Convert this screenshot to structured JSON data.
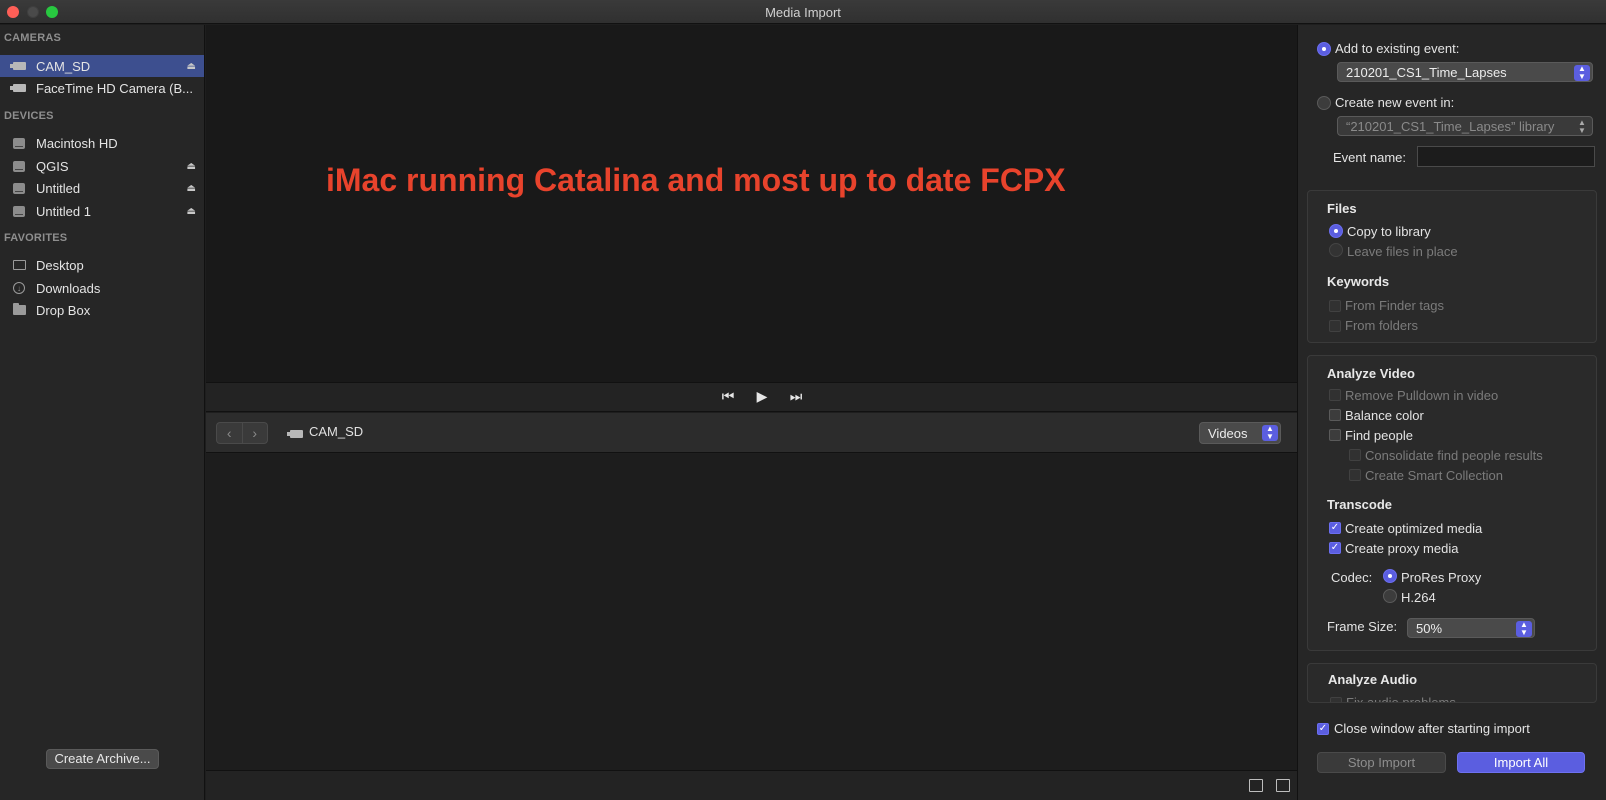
{
  "window": {
    "title": "Media Import"
  },
  "sidebar": {
    "cameras_header": "CAMERAS",
    "cameras": [
      {
        "label": "CAM_SD",
        "selected": true,
        "eject": true
      },
      {
        "label": "FaceTime HD Camera (B..."
      }
    ],
    "devices_header": "DEVICES",
    "devices": [
      {
        "label": "Macintosh HD"
      },
      {
        "label": "QGIS",
        "eject": true
      },
      {
        "label": "Untitled",
        "eject": true
      },
      {
        "label": "Untitled 1",
        "eject": true
      }
    ],
    "favorites_header": "FAVORITES",
    "favorites": [
      {
        "label": "Desktop"
      },
      {
        "label": "Downloads"
      },
      {
        "label": "Drop Box"
      }
    ],
    "eject_glyph": "⏏",
    "create_archive_label": "Create Archive..."
  },
  "viewer": {
    "overlay_text": "iMac running Catalina and most up to date FCPX"
  },
  "browser": {
    "location_label": "CAM_SD",
    "filter_value": "Videos"
  },
  "options": {
    "add_existing_label": "Add to existing event:",
    "existing_event_value": "210201_CS1_Time_Lapses",
    "create_new_label": "Create new event in:",
    "new_event_library": "“210201_CS1_Time_Lapses” library",
    "event_name_label": "Event name:",
    "event_name_value": "",
    "files_header": "Files",
    "copy_to_library": "Copy to library",
    "leave_in_place": "Leave files in place",
    "keywords_header": "Keywords",
    "from_finder_tags": "From Finder tags",
    "from_folders": "From folders",
    "analyze_video_header": "Analyze Video",
    "remove_pulldown": "Remove Pulldown in video",
    "balance_color": "Balance color",
    "find_people": "Find people",
    "consolidate_people": "Consolidate find people results",
    "create_smart_collection": "Create Smart Collection",
    "transcode_header": "Transcode",
    "create_optimized": "Create optimized media",
    "create_proxy": "Create proxy media",
    "codec_label": "Codec:",
    "codec_prores_proxy": "ProRes Proxy",
    "codec_h264": "H.264",
    "frame_size_label": "Frame Size:",
    "frame_size_value": "50%",
    "analyze_audio_header": "Analyze Audio",
    "fix_audio_partial": "Fix audio problems",
    "close_window_label": "Close window after starting import",
    "stop_import_label": "Stop Import",
    "import_all_label": "Import All"
  },
  "colors": {
    "accent": "#5b5ee0",
    "selection": "#3d4f8f",
    "overlay_text": "#e8432c"
  }
}
